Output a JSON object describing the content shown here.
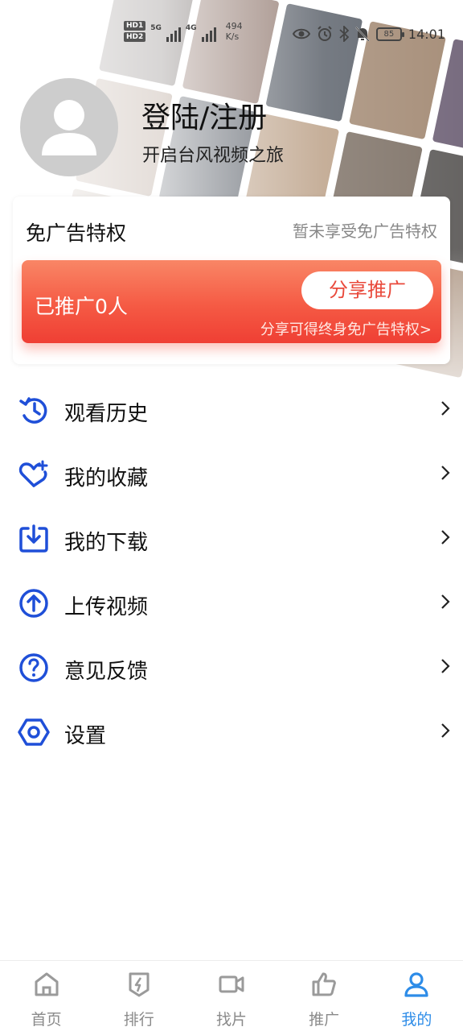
{
  "status_bar": {
    "hd1": "HD1",
    "hd2": "HD2",
    "net1": "5G",
    "net2": "4G",
    "speed_value": "494",
    "speed_unit": "K/s",
    "battery": "85",
    "time": "14:01",
    "icons": [
      "eye-icon",
      "alarm-icon",
      "bluetooth-icon",
      "bell-off-icon"
    ]
  },
  "profile": {
    "login_title": "登陆/注册",
    "subtitle": "开启台风视频之旅"
  },
  "vip": {
    "title": "免广告特权",
    "status": "暂未享受免广告特权",
    "promo_count": "已推广0人",
    "share_button": "分享推广",
    "hint": "分享可得终身免广告特权>",
    "accent": "#f55a44"
  },
  "menu": {
    "items": [
      {
        "label": "观看历史",
        "icon": "history-icon"
      },
      {
        "label": "我的收藏",
        "icon": "heart-plus-icon"
      },
      {
        "label": "我的下载",
        "icon": "download-icon"
      },
      {
        "label": "上传视频",
        "icon": "upload-icon"
      },
      {
        "label": "意见反馈",
        "icon": "help-icon"
      },
      {
        "label": "设置",
        "icon": "settings-icon"
      }
    ],
    "icon_color": "#1f4fd8"
  },
  "tabs": {
    "items": [
      {
        "label": "首页",
        "icon": "home-icon"
      },
      {
        "label": "排行",
        "icon": "ranking-icon"
      },
      {
        "label": "找片",
        "icon": "video-camera-icon"
      },
      {
        "label": "推广",
        "icon": "thumbs-up-icon"
      },
      {
        "label": "我的",
        "icon": "user-icon"
      }
    ],
    "active": "我的",
    "active_color": "#2d8ce8"
  }
}
